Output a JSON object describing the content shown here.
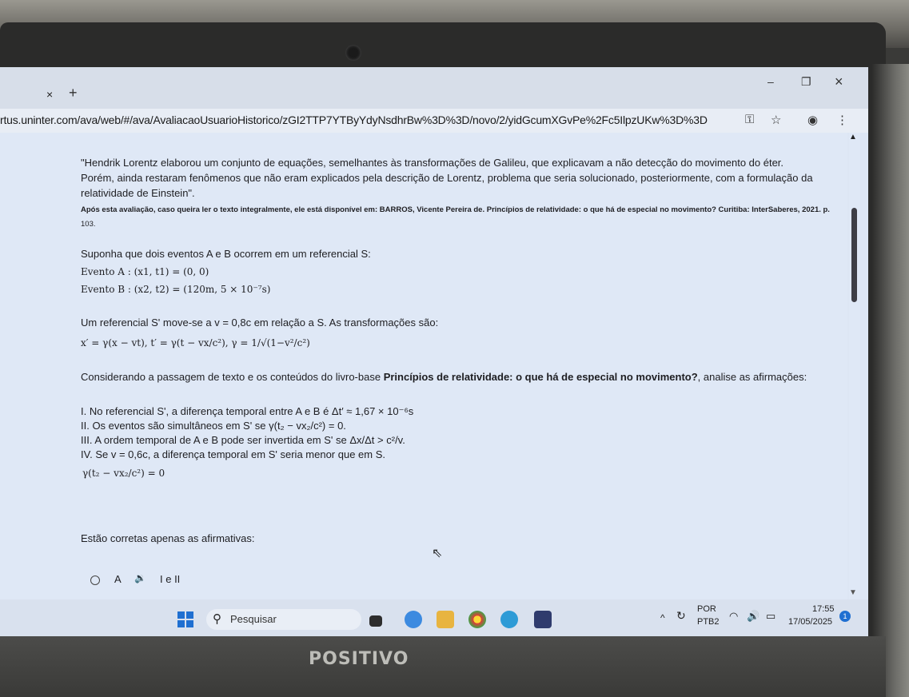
{
  "browser": {
    "tab_close": "×",
    "new_tab": "+",
    "minimize": "–",
    "maximize": "❐",
    "close": "×",
    "url": "rtus.uninter.com/ava/web/#/ava/AvaliacaoUsuarioHistorico/zGI2TTP7YTByYdyNsdhrBw%3D%3D/novo/2/yidGcumXGvPe%2Fc5IlpzUKw%3D%3D"
  },
  "question": {
    "quote_line1": "\"Hendrik Lorentz elaborou um conjunto de equações, semelhantes às transformações de Galileu, que explicavam a não detecção do movimento do éter.",
    "quote_line2": "Porém, ainda restaram fenômenos que não eram explicados pela descrição de Lorentz, problema que seria solucionado, posteriormente, com a formulação da",
    "quote_line3": "relatividade de Einstein\".",
    "source_line1": "Após esta avaliação, caso queira ler o texto integralmente, ele está disponível em: BARROS, Vicente Pereira de. Princípios de relatividade: o que há de especial no movimento? Curitiba: InterSaberes, 2021. p.",
    "source_line2": "103.",
    "suppose": "Suponha que dois eventos A e B ocorrem em um referencial S:",
    "event_a": "Evento A : (x1, t1) = (0, 0)",
    "event_b": "Evento B : (x2, t2) = (120m, 5 × 10⁻⁷s)",
    "frame_moves": "Um referencial S' move-se a v = 0,8c em relação a S. As transformações são:",
    "transformations": "x′ = γ(x − vt),    t′ = γ(t − vx/c²),    γ = 1/√(1−v²/c²)",
    "considering_prefix": "Considerando a passagem de texto e os conteúdos do livro-base ",
    "considering_book": "Princípios de relatividade: o que há de especial no movimento?",
    "considering_suffix": ", analise as afirmações:",
    "stmt1": "I. No referencial S', a diferença temporal entre A e B é Δt′ ≈ 1,67 × 10⁻⁶s",
    "stmt2": "II. Os eventos são simultâneos em S' se γ(t₂ − vx₂/c²) = 0.",
    "stmt3": "III. A ordem temporal de A e B pode ser invertida em S' se Δx/Δt > c²/v.",
    "stmt4": "IV. Se v = 0,6c, a diferença temporal em S' seria menor que em S.",
    "extra_formula": "γ(t₂ − vx₂/c²) = 0",
    "correct_prompt": "Estão corretas apenas as afirmativas:",
    "option_a_letter": "A",
    "option_a_text": "I e II"
  },
  "taskbar": {
    "search_placeholder": "Pesquisar",
    "lang_top": "POR",
    "lang_bottom": "PTB2",
    "time": "17:55",
    "date": "17/05/2025",
    "notification_count": "1"
  },
  "device": {
    "brand": "POSITIVO"
  },
  "colors": {
    "page_bg": "#dfe8f6",
    "accent": "#1f6fd1"
  }
}
